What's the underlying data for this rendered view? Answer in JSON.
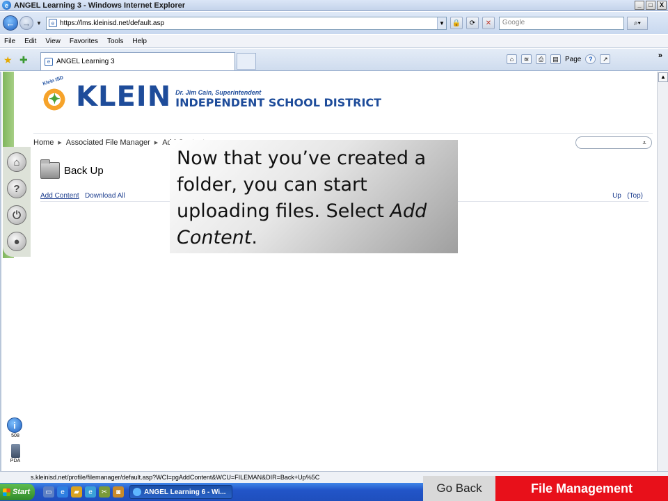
{
  "window": {
    "title": "ANGEL Learning 3 - Windows Internet Explorer",
    "controls": [
      "_",
      "□",
      "X"
    ]
  },
  "address_bar": {
    "url": "https://lms.kleinisd.net/default.asp",
    "search_placeholder": "Google"
  },
  "menu_bar": {
    "items": [
      "File",
      "Edit",
      "View",
      "Favorites",
      "Tools",
      "Help"
    ]
  },
  "tabs": {
    "active_tab": "ANGEL Learning 3",
    "command_labels": {
      "page": "Page"
    }
  },
  "header": {
    "logo_seal_text": "Klein ISD",
    "logo_main": "KLEIN",
    "logo_superintendent": "Dr. Jim Cain, Superintendent",
    "logo_district": "INDEPENDENT SCHOOL DISTRICT"
  },
  "breadcrumb": {
    "items": [
      "Home",
      "Associated File Manager",
      "Add Content"
    ]
  },
  "content": {
    "folder_name": "Back Up",
    "actions": {
      "add_content": "Add Content",
      "download_all": "Download All"
    },
    "nav": {
      "up": "Up",
      "top": "(Top)"
    }
  },
  "sidebar": {
    "icons": [
      "home-icon",
      "help-icon",
      "power-icon",
      "profile-icon"
    ],
    "tool_508_label": "508",
    "pda_label": "PDA"
  },
  "callout": {
    "text_main": "Now that you’ve created a folder, you can start uploading files. Select ",
    "text_emphasis": "Add Content",
    "text_end": "."
  },
  "status_bar": {
    "text": "s.kleinisd.net/profile/filemanager/default.asp?WCI=pgAddContent&WCU=FILEMAN&DIR=Back+Up%5C"
  },
  "taskbar": {
    "start_label": "Start",
    "task_label": "ANGEL Learning 6 - Wi..."
  },
  "tutorial_nav": {
    "go_back_label": "Go Back",
    "section_label": "File Management"
  },
  "colors": {
    "klein_blue": "#1e4c9a",
    "green_bar": "#7fb65d",
    "section_red": "#e8101a",
    "go_back_gray": "#d9d9d9"
  }
}
